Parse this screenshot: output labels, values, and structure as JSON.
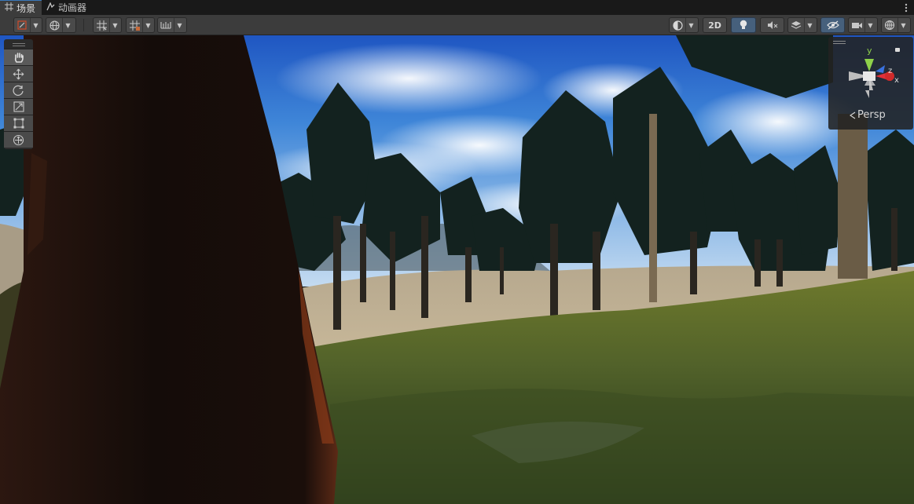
{
  "tabs": [
    {
      "label": "场景",
      "icon": "grid-icon",
      "active": true
    },
    {
      "label": "动画器",
      "icon": "animator-icon",
      "active": false
    }
  ],
  "tab_menu_icon": "more-vertical-icon",
  "toolbar": {
    "left": [
      {
        "name": "draw-mode-button",
        "icon": "shaded-draw-icon",
        "dropdown": true
      },
      {
        "name": "global-pivot-button",
        "icon": "globe-icon",
        "dropdown": true
      },
      {
        "name": "grid-snapping-button",
        "icon": "grid-snap-icon",
        "dropdown": true
      },
      {
        "name": "grid-visibility-button",
        "icon": "grid-icon",
        "dropdown": true
      },
      {
        "name": "increment-snap-button",
        "icon": "ruler-icon",
        "dropdown": true
      }
    ],
    "right": [
      {
        "name": "shading-mode-button",
        "icon": "sphere-icon",
        "dropdown": true
      },
      {
        "name": "2d-toggle",
        "label": "2D"
      },
      {
        "name": "lighting-toggle",
        "icon": "lightbulb-icon",
        "active": true
      },
      {
        "name": "audio-toggle",
        "icon": "speaker-mute-icon"
      },
      {
        "name": "effects-button",
        "icon": "layers-icon",
        "dropdown": true
      },
      {
        "name": "hidden-objects-toggle",
        "icon": "eye-slash-icon",
        "active": true
      },
      {
        "name": "camera-button",
        "icon": "camera-icon",
        "dropdown": true
      },
      {
        "name": "gizmos-button",
        "icon": "gizmo-sphere-icon",
        "dropdown": true
      }
    ],
    "label_2d": "2D"
  },
  "tools": [
    {
      "name": "hand-tool",
      "icon": "hand-icon",
      "active": true
    },
    {
      "name": "move-tool",
      "icon": "move-arrows-icon"
    },
    {
      "name": "rotate-tool",
      "icon": "rotate-icon"
    },
    {
      "name": "scale-tool",
      "icon": "scale-icon"
    },
    {
      "name": "rect-tool",
      "icon": "rect-icon"
    },
    {
      "name": "transform-tool",
      "icon": "transform-icon"
    }
  ],
  "gizmo": {
    "y_label": "y",
    "x_label": "x",
    "z_label": "z",
    "projection_label": "Persp",
    "colors": {
      "y": "#8fd14a",
      "x": "#e0303a",
      "z": "#3a72e0"
    }
  },
  "colors": {
    "accent": "#3a79bb",
    "toolbar_bg": "#3c3c3c",
    "active_button": "#46607c"
  }
}
